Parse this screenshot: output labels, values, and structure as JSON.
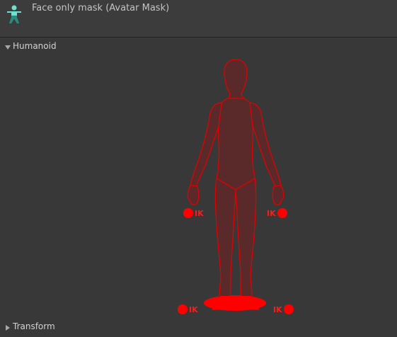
{
  "header": {
    "title": "Face only mask (Avatar Mask)",
    "icon": "avatar-mask-icon"
  },
  "sections": {
    "humanoid": {
      "label": "Humanoid",
      "expanded": true
    },
    "transform": {
      "label": "Transform",
      "expanded": false
    }
  },
  "ik_goals": {
    "left_hand": "IK",
    "right_hand": "IK",
    "left_foot": "IK",
    "right_foot": "IK"
  },
  "colors": {
    "disabled_body_fill": "#5a2a2a",
    "body_outline": "#e00000",
    "ik_dot": "#ff0000"
  }
}
